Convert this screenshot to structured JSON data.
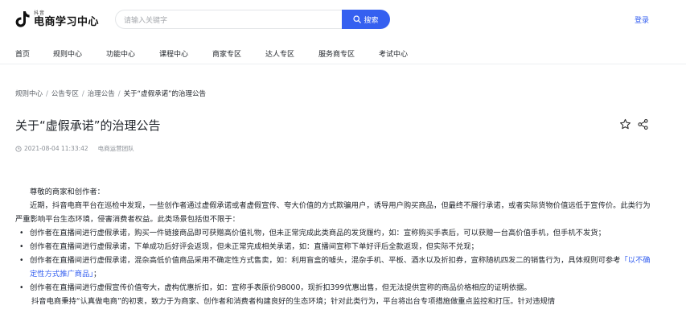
{
  "header": {
    "logo_small": "抖音",
    "logo_main": "电商学习中心",
    "search_placeholder": "请输入关键字",
    "search_button": "搜索",
    "login": "登录"
  },
  "nav": {
    "items": [
      "首页",
      "规则中心",
      "功能中心",
      "课程中心",
      "商家专区",
      "达人专区",
      "服务商专区",
      "考试中心"
    ]
  },
  "breadcrumb": {
    "items": [
      "规则中心",
      "公告专区",
      "治理公告"
    ],
    "current": "关于“虚假承诺”的治理公告",
    "separator": "/"
  },
  "article": {
    "title": "关于“虚假承诺”的治理公告",
    "date": "2021-08-04 11:33:42",
    "author": "电商运营团队",
    "greeting": "尊敬的商家和创作者：",
    "intro": "近期，抖音电商平台在巡检中发现，一些创作者通过虚假承诺或者虚假宣传、夸大价值的方式欺骗用户，诱导用户购买商品，但最终不履行承诺，或者实际货物价值远低于宣传价。此类行为严重影响平台生态环境，侵害消费者权益。此类场景包括但不限于：",
    "bullets": [
      "创作者在直播间进行虚假承诺，购买一件链接商品即可获赠高价值礼物，但未正常完成此类商品的发货履约，如：宣称购买手表后，可以获赠一台高价值手机，但手机不发货；",
      "创作者在直播间进行虚假承诺，下单成功后好评会返现，但未正常完成相关承诺，如：直播间宣称下单好评后全款返现，但实际不兑现；"
    ],
    "bullet3_prefix": "创作者在直播间进行虚假承诺，混杂高低价值商品采用不确定性方式售卖，如：利用盲盒的噱头，混杂手机、平板、酒水以及折扣券，宣称随机四发二的销售行为，具体规则可参考",
    "bullet3_link": "「以不确定性方式推广商品」",
    "bullet3_suffix": "；",
    "bullet4": "创作者在直播间进行虚假宣传价值夸大，虚构优惠折扣，如：宣称手表原价98000，现折扣399优惠出售，但无法提供宣称的商品价格相应的证明依据。",
    "closing": "抖音电商秉持“认真做电商”的初衷，致力于为商家、创作者和消费者构建良好的生态环境；针对此类行为，平台将出台专项措施做重点监控和打压。针对违规情"
  },
  "colors": {
    "accent": "#3560f0",
    "text": "#1f2329",
    "muted": "#8a8f96"
  }
}
